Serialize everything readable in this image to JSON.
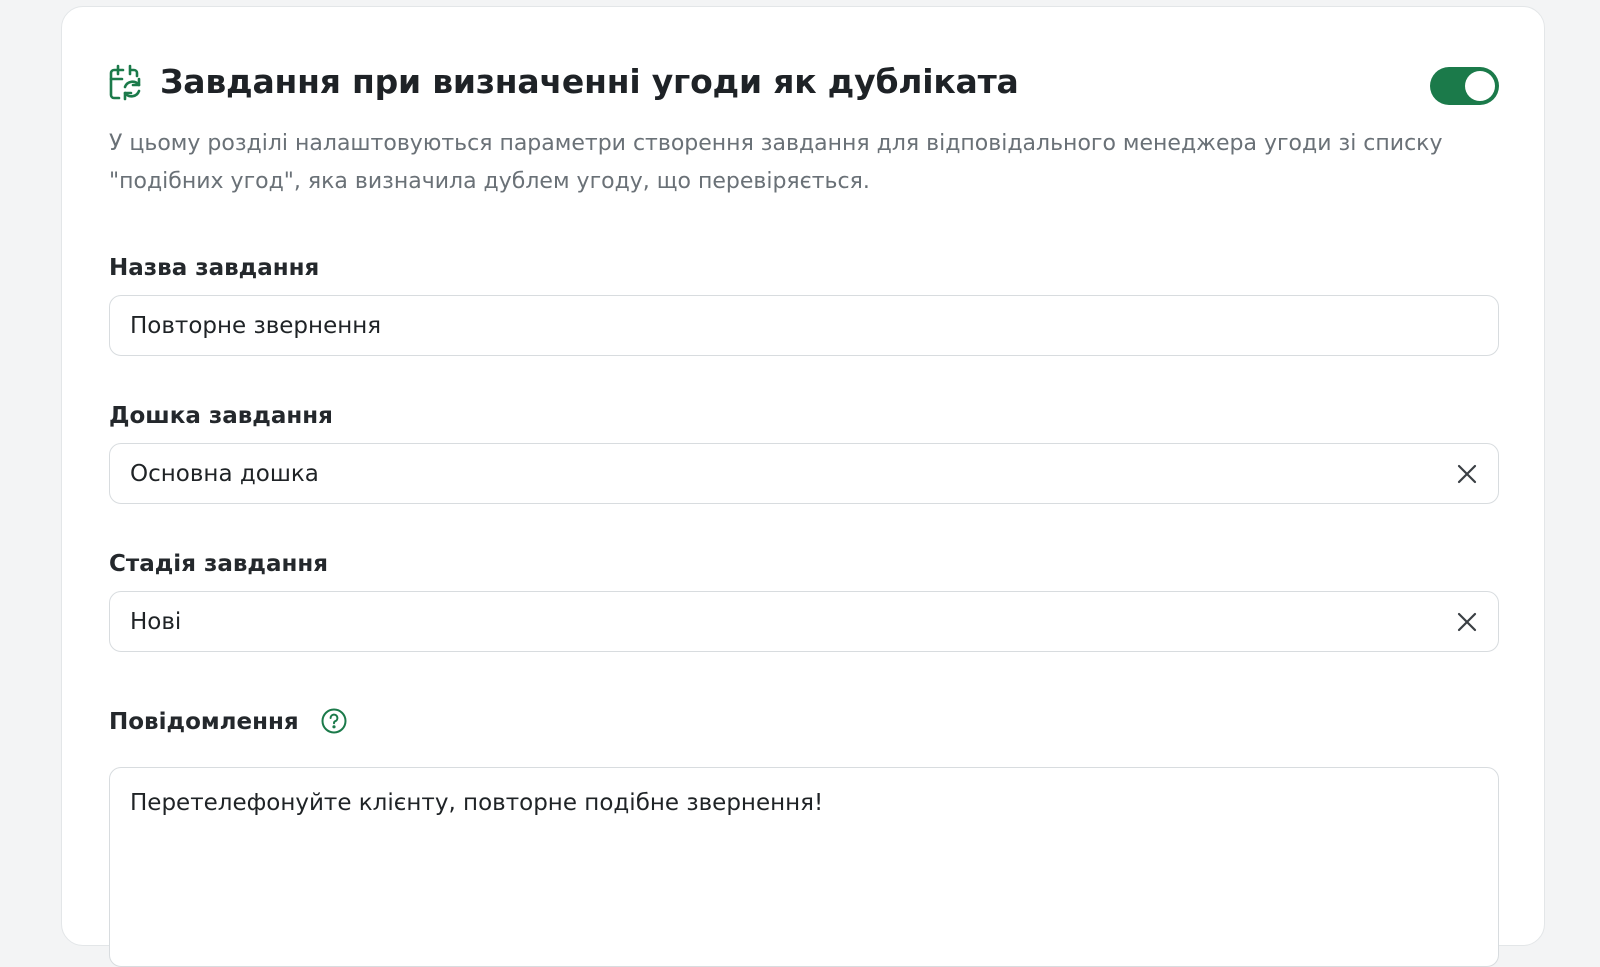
{
  "section": {
    "title": "Завдання при визначенні угоди як дубліката",
    "description": "У цьому розділі налаштовуються параметри створення завдання для відповідального менеджера угоди зі списку \"подібних угод\", яка визначила дублем угоду, що перевіряється.",
    "enabled": true,
    "accent_color": "#1b7a4a",
    "icon": "calendar-repeat-icon"
  },
  "fields": {
    "task_name": {
      "label": "Назва завдання",
      "value": "Повторне звернення"
    },
    "task_board": {
      "label": "Дошка завдання",
      "value": "Основна дошка"
    },
    "task_stage": {
      "label": "Стадія завдання",
      "value": "Нові"
    },
    "message": {
      "label": "Повідомлення",
      "value": "Перетелефонуйте клієнту, повторне подібне звернення!"
    }
  }
}
